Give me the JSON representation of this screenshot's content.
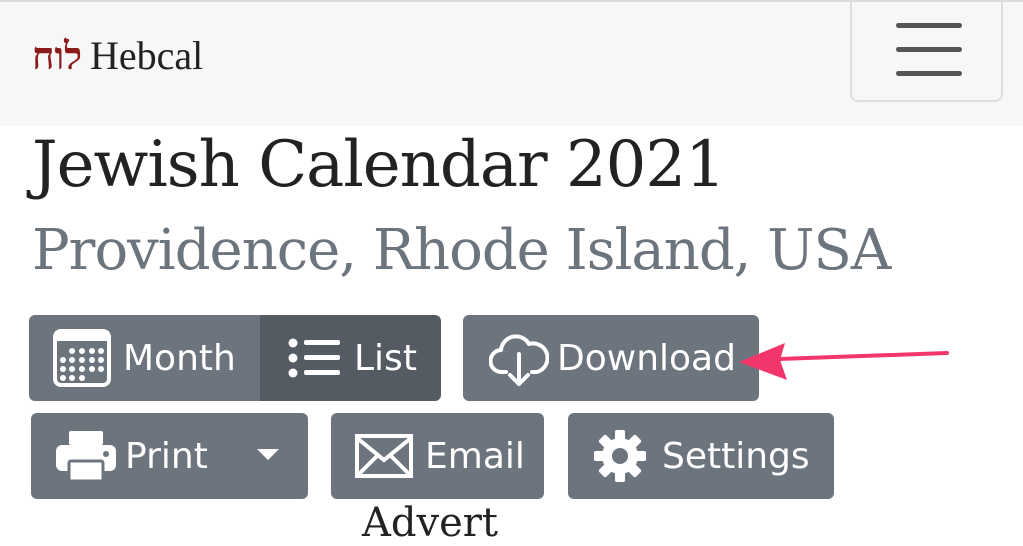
{
  "navbar": {
    "brand_hebrew": "לוח",
    "brand_name": "Hebcal",
    "menu_icon": "hamburger-menu-icon"
  },
  "page": {
    "title": "Jewish Calendar 2021",
    "subtitle": "Providence, Rhode Island, USA",
    "next_heading_partial": "Advert"
  },
  "toolbar": {
    "month_label": "Month",
    "list_label": "List",
    "download_label": "Download",
    "print_label": "Print",
    "email_label": "Email",
    "settings_label": "Settings",
    "icons": {
      "month": "calendar-grid-icon",
      "list": "list-icon",
      "download": "cloud-download-icon",
      "print": "printer-icon",
      "email": "envelope-icon",
      "settings": "gear-icon"
    },
    "active_view": "List"
  },
  "colors": {
    "button_bg": "#6c757d",
    "button_active_bg": "#545b62",
    "brand_red": "#8b1a1a",
    "annotation_arrow": "#f2366b",
    "subtitle": "#6c757d"
  }
}
